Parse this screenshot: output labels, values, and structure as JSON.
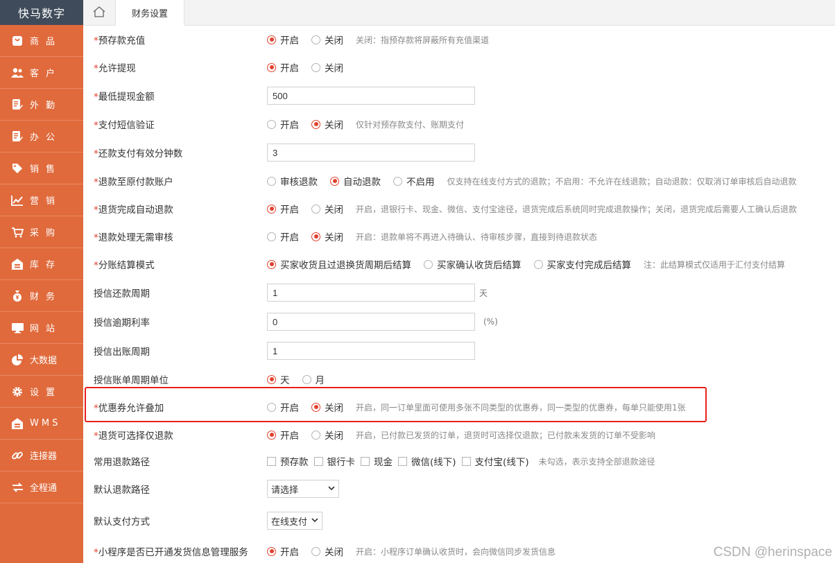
{
  "brand": "快马数字",
  "sidebar": {
    "items": [
      {
        "label": "商品",
        "icon": "bag-icon"
      },
      {
        "label": "客户",
        "icon": "users-icon"
      },
      {
        "label": "外勤",
        "icon": "clipboard-edit-icon"
      },
      {
        "label": "办公",
        "icon": "clipboard-edit-icon"
      },
      {
        "label": "销售",
        "icon": "tag-icon"
      },
      {
        "label": "营销",
        "icon": "chart-line-icon"
      },
      {
        "label": "采购",
        "icon": "cart-icon"
      },
      {
        "label": "库存",
        "icon": "warehouse-icon"
      },
      {
        "label": "财务",
        "icon": "money-bag-icon"
      },
      {
        "label": "网站",
        "icon": "monitor-icon"
      },
      {
        "label": "大数据",
        "icon": "pie-chart-icon"
      },
      {
        "label": "设置",
        "icon": "gear-icon"
      },
      {
        "label": "WMS",
        "icon": "warehouse-icon"
      },
      {
        "label": "连接器",
        "icon": "link-icon"
      },
      {
        "label": "全程通",
        "icon": "exchange-icon"
      }
    ]
  },
  "tabs": {
    "home_icon": "home-icon",
    "active": "财务设置"
  },
  "form": {
    "prepay_recharge": {
      "label": "预存款充值",
      "opt1": "开启",
      "opt2": "关闭",
      "hint": "关闭：指预存款将屏蔽所有充值渠道"
    },
    "allow_withdraw": {
      "label": "允许提现",
      "opt1": "开启",
      "opt2": "关闭"
    },
    "min_withdraw": {
      "label": "最低提现金额",
      "value": "500"
    },
    "sms_verify": {
      "label": "支付短信验证",
      "opt1": "开启",
      "opt2": "关闭",
      "hint": "仅针对预存款支付、账期支付"
    },
    "repay_minutes": {
      "label": "还款支付有效分钟数",
      "value": "3"
    },
    "refund_original": {
      "label": "退款至原付款账户",
      "opt1": "审核退款",
      "opt2": "自动退款",
      "opt3": "不启用",
      "hint": "仅支持在线支付方式的退款；不启用：不允许在线退款；自动退款：仅取消订单审核后自动退款"
    },
    "return_auto_refund": {
      "label": "退货完成自动退款",
      "opt1": "开启",
      "opt2": "关闭",
      "hint": "开启，退银行卡、现金、微信、支付宝途径，退货完成后系统同时完成退款操作；关闭，退货完成后需要人工确认后退款"
    },
    "refund_no_audit": {
      "label": "退款处理无需审核",
      "opt1": "开启",
      "opt2": "关闭",
      "hint": "开启：退款单将不再进入待确认、待审核步骤，直接到待退款状态"
    },
    "split_settle": {
      "label": "分账结算模式",
      "opt1": "买家收货且过退换货周期后结算",
      "opt2": "买家确认收货后结算",
      "opt3": "买家支付完成后结算",
      "hint": "注：此结算模式仅适用于汇付支付结算"
    },
    "credit_repay_period": {
      "label": "授信还款周期",
      "value": "1",
      "unit": "天"
    },
    "credit_overdue_rate": {
      "label": "授信逾期利率",
      "value": "0",
      "unit": "(%)"
    },
    "credit_bill_period": {
      "label": "授信出账周期",
      "value": "1"
    },
    "credit_bill_unit": {
      "label": "授信账单周期单位",
      "opt1": "天",
      "opt2": "月"
    },
    "coupon_stack": {
      "label": "优惠券允许叠加",
      "opt1": "开启",
      "opt2": "关闭",
      "hint": "开启，同一订单里面可使用多张不同类型的优惠券，同一类型的优惠券，每单只能使用1张"
    },
    "return_refund_only": {
      "label": "退货可选择仅退款",
      "opt1": "开启",
      "opt2": "关闭",
      "hint": "开启，已付款已发货的订单，退货时可选择仅退款；已付款未发货的订单不受影响"
    },
    "refund_paths": {
      "label": "常用退款路径",
      "items": [
        "预存款",
        "银行卡",
        "现金",
        "微信(线下)",
        "支付宝(线下)"
      ],
      "hint": "未勾选，表示支持全部退款途径"
    },
    "default_refund_path": {
      "label": "默认退款路径",
      "selected": "请选择"
    },
    "default_pay_method": {
      "label": "默认支付方式",
      "selected": "在线支付"
    },
    "miniprogram_ship": {
      "label": "小程序是否已开通发货信息管理服务",
      "opt1": "开启",
      "opt2": "关闭",
      "hint": "开启：小程序订单确认收货时，会向微信同步发货信息"
    }
  },
  "colors": {
    "sidebar_bg": "#e06a3c",
    "brand_bg": "#3f4b5a",
    "accent_red": "#e0412e",
    "highlight_box": "#e8201a"
  },
  "watermark": "CSDN @herinspace"
}
